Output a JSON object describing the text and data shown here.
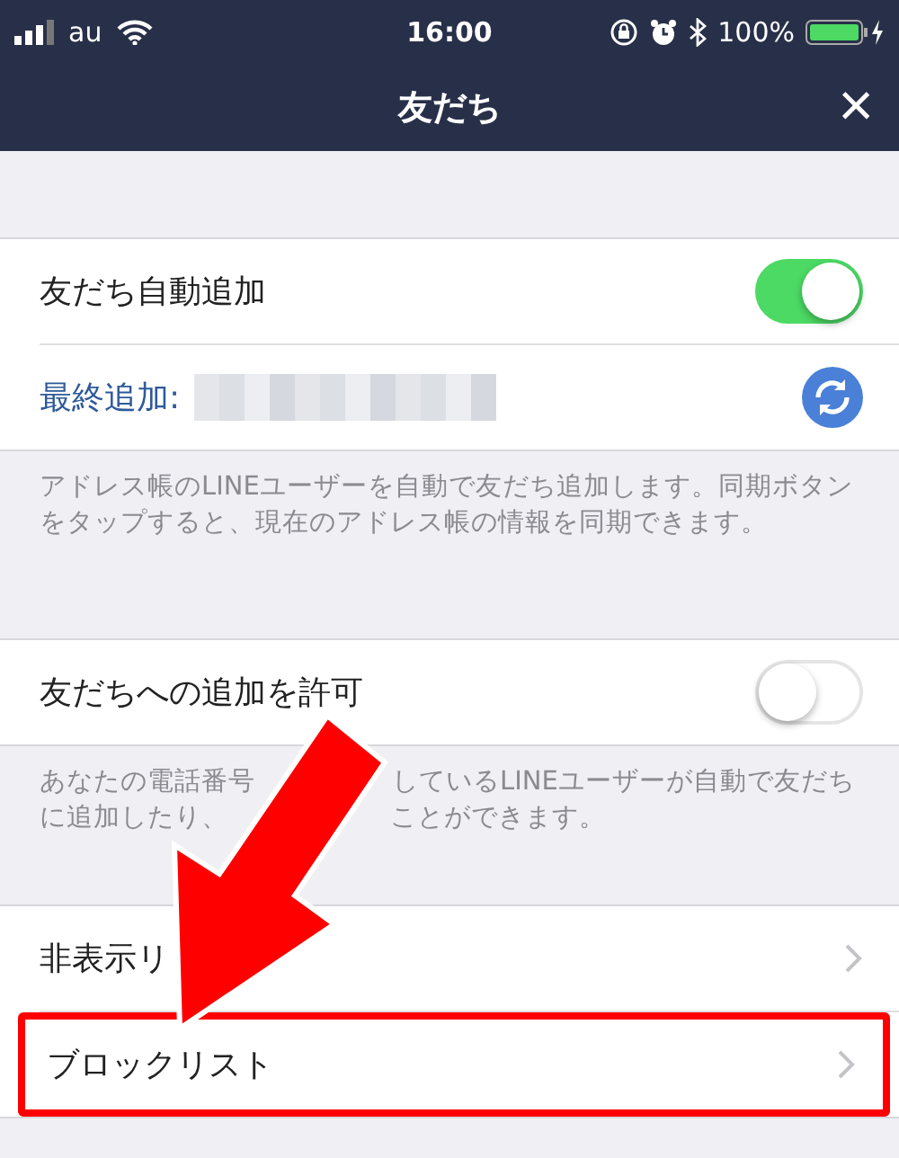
{
  "status_bar": {
    "carrier": "au",
    "time": "16:00",
    "battery": "100%"
  },
  "nav": {
    "title": "友だち",
    "close": "×"
  },
  "sections": [
    {
      "rows": [
        {
          "kind": "toggle",
          "label": "友だち自動追加",
          "on": true
        },
        {
          "kind": "sync",
          "label": "最終追加:"
        }
      ],
      "footnote": [
        [
          "アドレス帳のLINEユーザーを自動で友だち追加します。同期ボタンをタップすると、現在のアドレス帳の情報を同期できます。"
        ]
      ]
    },
    {
      "rows": [
        {
          "kind": "toggle",
          "label": "友だちへの追加を許可",
          "on": false
        }
      ],
      "footnote": [
        [
          "あなたの電話番号",
          "しているLINEユーザーが自動で友だち"
        ],
        [
          "に追加したり、",
          "ことができます。"
        ]
      ]
    },
    {
      "rows": [
        {
          "kind": "link",
          "label": "非表示リ",
          "highlighted": false
        },
        {
          "kind": "link",
          "label": "ブロックリスト",
          "highlighted": true
        }
      ]
    }
  ]
}
